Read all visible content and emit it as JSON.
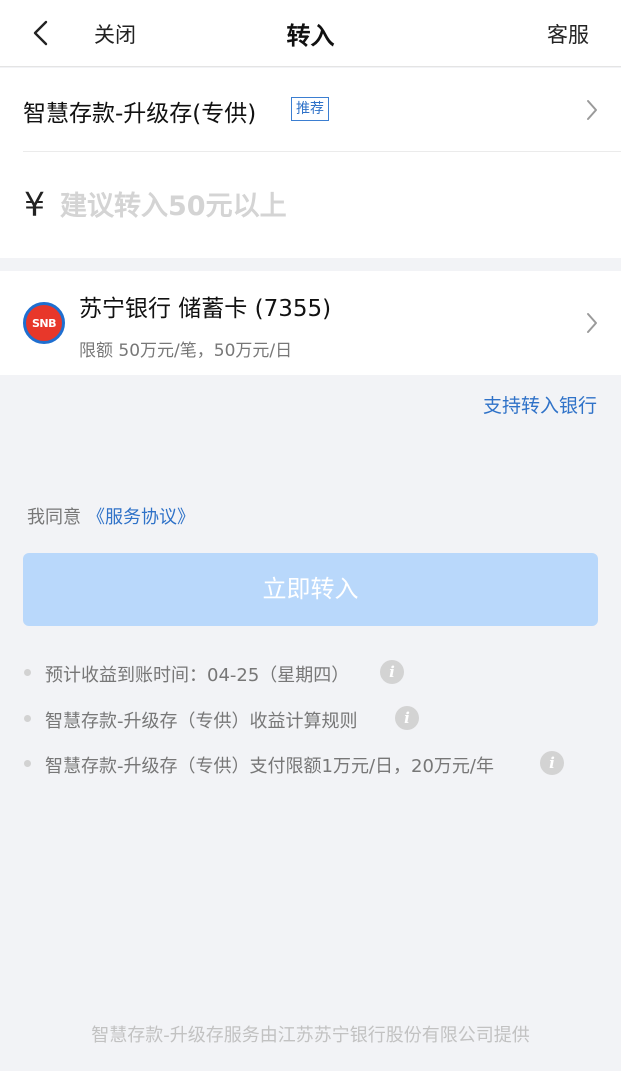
{
  "header": {
    "back_icon": "chevron-left-icon",
    "close_label": "关闭",
    "title": "转入",
    "service_label": "客服"
  },
  "product": {
    "name": "智慧存款-升级存(专供)",
    "badge": "推荐"
  },
  "amount": {
    "currency_symbol": "¥",
    "placeholder": "建议转入50元以上",
    "value": ""
  },
  "bank": {
    "logo_text": "SNB",
    "name": "苏宁银行 储蓄卡 (7355)",
    "limit": "限额 50万元/笔，50万元/日"
  },
  "support_banks_label": "支持转入银行",
  "agreement": {
    "prefix": "我同意",
    "link": "《服务协议》"
  },
  "submit_label": "立即转入",
  "info_items": [
    {
      "text": "预计收益到账时间：04-25（星期四）",
      "icon": "info-icon"
    },
    {
      "text": "智慧存款-升级存（专供）收益计算规则",
      "icon": "info-icon"
    },
    {
      "text": "智慧存款-升级存（专供）支付限额1万元/日，20万元/年",
      "icon": "info-icon"
    }
  ],
  "footer_note": "智慧存款-升级存服务由江苏苏宁银行股份有限公司提供",
  "colors": {
    "accent": "#2f72c8",
    "button_disabled": "#b9d8fb",
    "page_background": "#f2f3f6"
  }
}
